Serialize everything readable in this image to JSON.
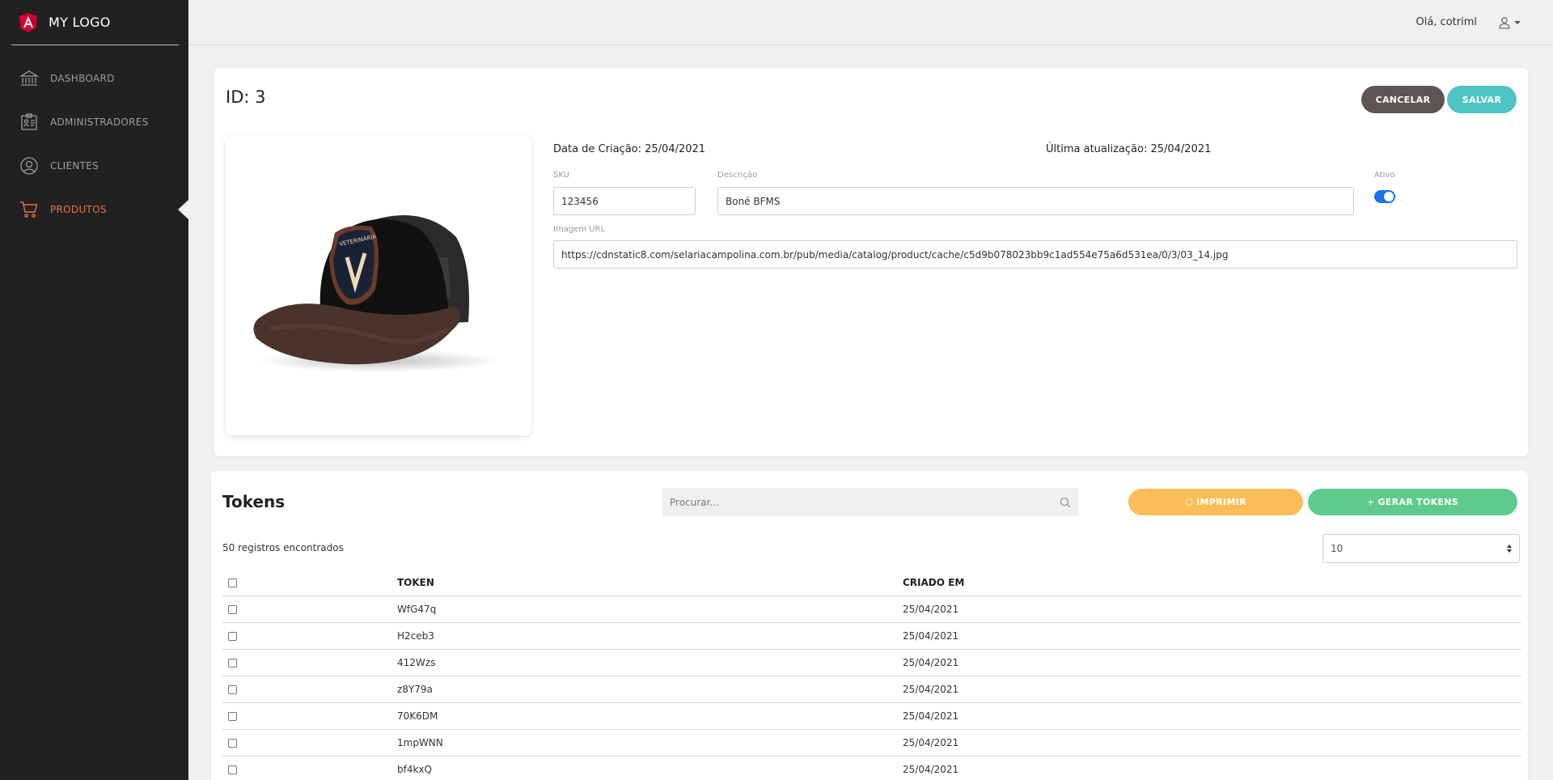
{
  "brand": {
    "logo_text": "MY LOGO",
    "accent": "#dd0031"
  },
  "sidebar": {
    "items": [
      {
        "label": "DASHBOARD",
        "icon": "bank-icon",
        "active": false
      },
      {
        "label": "ADMINISTRADORES",
        "icon": "id-card-icon",
        "active": false
      },
      {
        "label": "CLIENTES",
        "icon": "user-circle-icon",
        "active": false
      },
      {
        "label": "PRODUTOS",
        "icon": "cart-icon",
        "active": true
      }
    ]
  },
  "topbar": {
    "greeting": "Olá, cotriml",
    "user_icon": "user-icon"
  },
  "product": {
    "title": "ID: 3",
    "cancel_label": "CANCELAR",
    "save_label": "SALVAR",
    "created": "Data de Criação: 25/04/2021",
    "updated": "Última atualização: 25/04/2021",
    "sku_label": "SKU",
    "sku_value": "123456",
    "desc_label": "Descrição",
    "desc_value": "Boné BFMS",
    "active_label": "Ativo",
    "active": true,
    "image_url_label": "Imagem URL",
    "image_url_value": "https://cdnstatic8.com/selariacampolina.com.br/pub/media/catalog/product/cache/c5d9b078023bb9c1ad554e75a6d531ea/0/3/03_14.jpg"
  },
  "tokens": {
    "title": "Tokens",
    "search_placeholder": "Procurar...",
    "print_label": "IMPRIMIR",
    "generate_label": "GERAR TOKENS",
    "records": "50 registros encontrados",
    "page_size": "10",
    "columns": [
      "TOKEN",
      "CRIADO EM"
    ],
    "rows": [
      {
        "token": "WfG47q",
        "created": "25/04/2021"
      },
      {
        "token": "H2ceb3",
        "created": "25/04/2021"
      },
      {
        "token": "412Wzs",
        "created": "25/04/2021"
      },
      {
        "token": "z8Y79a",
        "created": "25/04/2021"
      },
      {
        "token": "70K6DM",
        "created": "25/04/2021"
      },
      {
        "token": "1mpWNN",
        "created": "25/04/2021"
      },
      {
        "token": "bf4kxQ",
        "created": "25/04/2021"
      }
    ]
  }
}
